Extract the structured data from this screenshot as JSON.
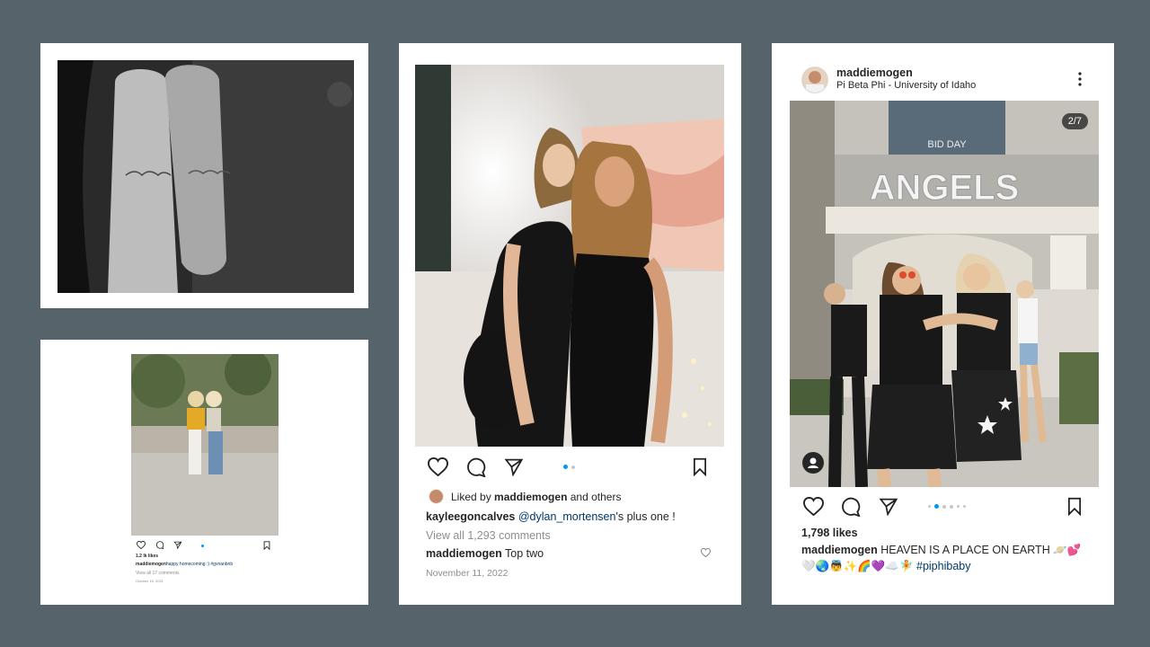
{
  "card_a": {
    "post": {
      "icon_names": [
        "heart-icon",
        "comment-icon",
        "share-icon",
        "bookmark-icon"
      ],
      "likes": "1.2 lk likes",
      "caption_user": "maddiemogen",
      "caption_text": "happy homecoming :) #gvnanbnb",
      "comments_link": "View all 17 comments",
      "date": "October 15, 2021"
    }
  },
  "card_b": {
    "icon_names": [
      "heart-icon",
      "comment-icon",
      "share-icon",
      "bookmark-icon"
    ],
    "liked_by_prefix": "Liked by",
    "liked_by_user": "maddiemogen",
    "liked_by_suffix": "and others",
    "caption_user": "kayleegoncalves",
    "caption_mention": "@dylan_mortensen",
    "caption_text": "'s plus one !",
    "comments_link": "View all 1,293 comments",
    "comment_user": "maddiemogen",
    "comment_text": "Top two",
    "date": "November 11, 2022",
    "carousel": {
      "index": 1,
      "total": 2
    }
  },
  "card_c": {
    "username": "maddiemogen",
    "location": "Pi Beta Phi - University of Idaho",
    "menu_icon": "more-vertical-icon",
    "photo_sign": "ANGELS",
    "banner_text": "BID DAY",
    "image_counter": "2/7",
    "icon_names": [
      "heart-icon",
      "comment-icon",
      "share-icon",
      "bookmark-icon",
      "user-tag-icon"
    ],
    "likes": "1,798 likes",
    "caption_user": "maddiemogen",
    "caption_text": "HEAVEN IS A PLACE ON EARTH 🪐💕",
    "caption_line2": "🤍🌏👼✨🌈💜☁️🧚",
    "hashtag": "#piphibaby",
    "carousel": {
      "index": 2,
      "total": 7
    }
  },
  "colors": {
    "background": "#56636a",
    "card": "#ffffff",
    "link": "#00376b",
    "active_dot": "#0095f6",
    "muted": "#8e8e8e"
  }
}
